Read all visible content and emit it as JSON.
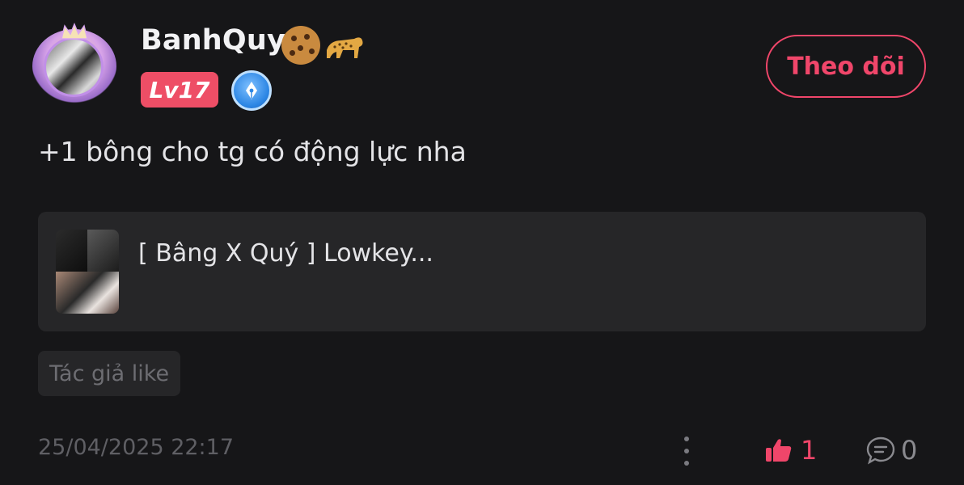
{
  "user": {
    "name": "BanhQuy",
    "emoji_icons": [
      "cookie-icon",
      "leopard-icon"
    ],
    "level": "Lv17",
    "badge_icon": "fountain-pen-icon"
  },
  "follow_button": {
    "label": "Theo dõi"
  },
  "comment": {
    "text": "+1 bông cho tg có động lực nha"
  },
  "reference": {
    "title": "[ Bâng X Quý ] Lowkey..."
  },
  "tag": {
    "label": "Tác giả like"
  },
  "footer": {
    "timestamp": "25/04/2025 22:17",
    "like_count": "1",
    "comment_count": "0"
  },
  "colors": {
    "background": "#161618",
    "accent": "#f0466a",
    "card": "#262628",
    "muted": "#5f5f64"
  }
}
